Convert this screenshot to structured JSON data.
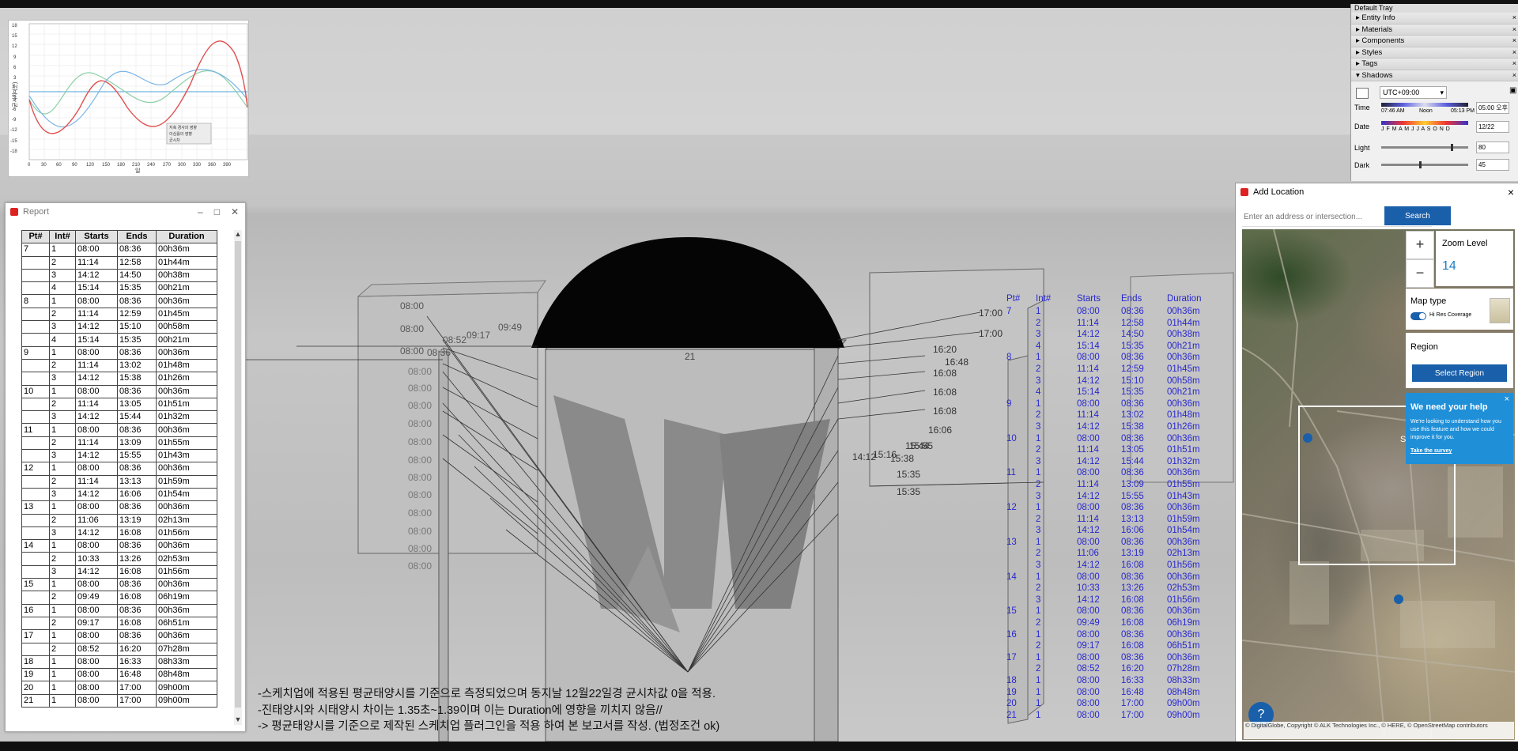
{
  "chart": {
    "y_ticks": [
      "18",
      "15",
      "12",
      "9",
      "6",
      "3",
      "0",
      "-3",
      "-6",
      "-9",
      "-12",
      "-15",
      "-18"
    ],
    "x_ticks": [
      "0",
      "30",
      "60",
      "90",
      "120",
      "150",
      "180",
      "210",
      "240",
      "270",
      "300",
      "330",
      "360",
      "390"
    ],
    "ylabel": "균시차 (분)",
    "xlabel": "일",
    "legend": [
      "지축 경사의 영향",
      "이심률의 영향",
      "균시차"
    ]
  },
  "report": {
    "title": "Report",
    "headers": [
      "Pt#",
      "Int#",
      "Starts",
      "Ends",
      "Duration"
    ],
    "rows": [
      [
        "7",
        "1",
        "08:00",
        "08:36",
        "00h36m"
      ],
      [
        "",
        "2",
        "11:14",
        "12:58",
        "01h44m"
      ],
      [
        "",
        "3",
        "14:12",
        "14:50",
        "00h38m"
      ],
      [
        "",
        "4",
        "15:14",
        "15:35",
        "00h21m"
      ],
      [
        "8",
        "1",
        "08:00",
        "08:36",
        "00h36m"
      ],
      [
        "",
        "2",
        "11:14",
        "12:59",
        "01h45m"
      ],
      [
        "",
        "3",
        "14:12",
        "15:10",
        "00h58m"
      ],
      [
        "",
        "4",
        "15:14",
        "15:35",
        "00h21m"
      ],
      [
        "9",
        "1",
        "08:00",
        "08:36",
        "00h36m"
      ],
      [
        "",
        "2",
        "11:14",
        "13:02",
        "01h48m"
      ],
      [
        "",
        "3",
        "14:12",
        "15:38",
        "01h26m"
      ],
      [
        "10",
        "1",
        "08:00",
        "08:36",
        "00h36m"
      ],
      [
        "",
        "2",
        "11:14",
        "13:05",
        "01h51m"
      ],
      [
        "",
        "3",
        "14:12",
        "15:44",
        "01h32m"
      ],
      [
        "11",
        "1",
        "08:00",
        "08:36",
        "00h36m"
      ],
      [
        "",
        "2",
        "11:14",
        "13:09",
        "01h55m"
      ],
      [
        "",
        "3",
        "14:12",
        "15:55",
        "01h43m"
      ],
      [
        "12",
        "1",
        "08:00",
        "08:36",
        "00h36m"
      ],
      [
        "",
        "2",
        "11:14",
        "13:13",
        "01h59m"
      ],
      [
        "",
        "3",
        "14:12",
        "16:06",
        "01h54m"
      ],
      [
        "13",
        "1",
        "08:00",
        "08:36",
        "00h36m"
      ],
      [
        "",
        "2",
        "11:06",
        "13:19",
        "02h13m"
      ],
      [
        "",
        "3",
        "14:12",
        "16:08",
        "01h56m"
      ],
      [
        "14",
        "1",
        "08:00",
        "08:36",
        "00h36m"
      ],
      [
        "",
        "2",
        "10:33",
        "13:26",
        "02h53m"
      ],
      [
        "",
        "3",
        "14:12",
        "16:08",
        "01h56m"
      ],
      [
        "15",
        "1",
        "08:00",
        "08:36",
        "00h36m"
      ],
      [
        "",
        "2",
        "09:49",
        "16:08",
        "06h19m"
      ],
      [
        "16",
        "1",
        "08:00",
        "08:36",
        "00h36m"
      ],
      [
        "",
        "2",
        "09:17",
        "16:08",
        "06h51m"
      ],
      [
        "17",
        "1",
        "08:00",
        "08:36",
        "00h36m"
      ],
      [
        "",
        "2",
        "08:52",
        "16:20",
        "07h28m"
      ],
      [
        "18",
        "1",
        "08:00",
        "16:33",
        "08h33m"
      ],
      [
        "19",
        "1",
        "08:00",
        "16:48",
        "08h48m"
      ],
      [
        "20",
        "1",
        "08:00",
        "17:00",
        "09h00m"
      ],
      [
        "21",
        "1",
        "08:00",
        "17:00",
        "09h00m"
      ]
    ]
  },
  "notes": [
    "-스케치업에 적용된 평균태양시를 기준으로 측정되었으며 동지날 12월22일경 균시차값 0을 적용.",
    "-진태양시와 시태양시 차이는 1.35초~1.39이며 이는  Duration에 영향을 끼치지 않음//",
    "->  평균태양시를 기준으로 제작된 스케치업 플러그인을 적용 하여 본 보고서를 작성. (법정조건 ok)"
  ],
  "scene_labels": {
    "left": [
      "08:00",
      "08:00",
      "08:00",
      "08:00",
      "08:00",
      "08:00",
      "08:00",
      "08:00",
      "08:00",
      "08:00",
      "08:00",
      "08:00",
      "08:00",
      "08:00",
      "08:00"
    ],
    "mid": [
      "09:49",
      "09:17",
      "08:52",
      "08:36",
      "08:36"
    ],
    "right": [
      "17:00",
      "17:00",
      "16:20",
      "16:08",
      "16:08",
      "16:08",
      "16:08",
      "16:06",
      "15:55",
      "15:44",
      "15:38",
      "15:35",
      "15:35",
      "14:12",
      "16:48",
      "15:16"
    ],
    "center_top": "21"
  },
  "tray": {
    "title": "Default Tray",
    "sections": [
      "Entity Info",
      "Materials",
      "Components",
      "Styles",
      "Tags",
      "Shadows"
    ],
    "timezone": "UTC+09:00",
    "time_label": "Time",
    "time_start": "07:46 AM",
    "time_noon": "Noon",
    "time_end": "05:13 PM",
    "time_value": "05:00 오후",
    "date_label": "Date",
    "months": "J F M A M J J A S O N D",
    "date_value": "12/22",
    "light_label": "Light",
    "light_value": "80",
    "dark_label": "Dark",
    "dark_value": "45"
  },
  "addloc": {
    "title": "Add Location",
    "search_placeholder": "Enter an address or intersection...",
    "search_btn": "Search",
    "zoom_title": "Zoom Level",
    "zoom_plus": "+",
    "zoom_minus": "−",
    "zoom_value": "14",
    "maptype_title": "Map type",
    "maptype_toggle": "Hi Res Coverage",
    "region_title": "Region",
    "region_btn": "Select Region",
    "survey_title": "We need your help",
    "survey_body": "We're looking to understand how you use this feature and how we could improve it for you.",
    "survey_link": "Take the survey",
    "map_label": "Su",
    "copyright": "© DigitalGlobe, Copyright © ALK Technologies Inc., © HERE, © OpenStreetMap contributors",
    "help": "?"
  },
  "colors": {
    "blue_text": "#2828d0",
    "search_btn": "#1a5fa9",
    "survey_bg": "#1f8fd8",
    "zoom_value": "#1a7fc4"
  }
}
